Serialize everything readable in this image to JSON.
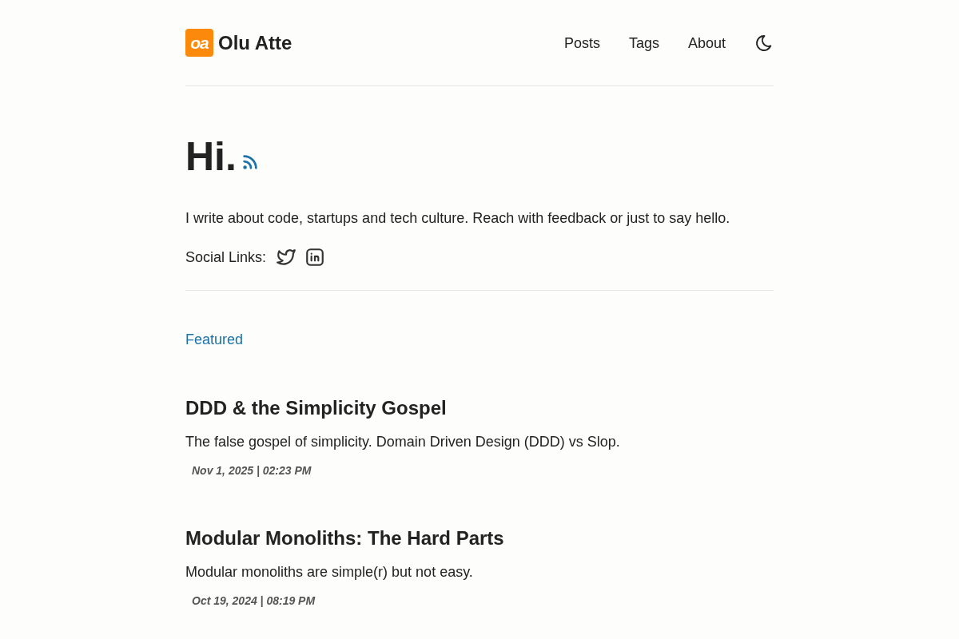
{
  "header": {
    "logo_mark": "oa",
    "site_title": "Olu Atte",
    "nav": [
      {
        "label": "Posts"
      },
      {
        "label": "Tags"
      },
      {
        "label": "About"
      }
    ]
  },
  "hero": {
    "heading": "Hi.",
    "intro": "I write about code, startups and tech culture. Reach with feedback or just to say hello.",
    "social_label": "Social Links:",
    "social_links": [
      {
        "kind": "twitter"
      },
      {
        "kind": "linkedin"
      }
    ]
  },
  "featured": {
    "heading": "Featured",
    "posts": [
      {
        "title": "DDD & the Simplicity Gospel",
        "description": "The false gospel of simplicity. Domain Driven Design (DDD) vs Slop.",
        "date": "Nov 1, 2025 | 02:23 PM"
      },
      {
        "title": "Modular Monoliths: The Hard Parts",
        "description": "Modular monoliths are simple(r) but not easy.",
        "date": "Oct 19, 2024 | 08:19 PM"
      }
    ]
  }
}
